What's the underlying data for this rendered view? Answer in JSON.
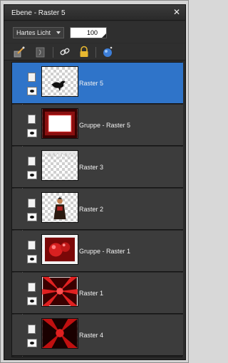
{
  "panel": {
    "title": "Ebene - Raster 5",
    "close_icon": "close-icon"
  },
  "controls": {
    "blend_mode": "Hartes Licht",
    "opacity": "100"
  },
  "toolbar": {
    "icons": [
      "edit-brush-icon",
      "mask-icon",
      "link-icon",
      "lock-icon",
      "effects-icon"
    ]
  },
  "layers": [
    {
      "name": "Raster 5",
      "selected": true,
      "thumb": "bird"
    },
    {
      "name": "Gruppe - Raster 5",
      "selected": false,
      "thumb": "red-frame"
    },
    {
      "name": "Raster 3",
      "selected": false,
      "thumb": "icicles"
    },
    {
      "name": "Raster 2",
      "selected": false,
      "thumb": "figure"
    },
    {
      "name": "Gruppe - Raster 1",
      "selected": false,
      "thumb": "red-balls"
    },
    {
      "name": "Raster 1",
      "selected": false,
      "thumb": "red-burst"
    },
    {
      "name": "Raster 4",
      "selected": false,
      "thumb": "red-burst-dark"
    }
  ]
}
